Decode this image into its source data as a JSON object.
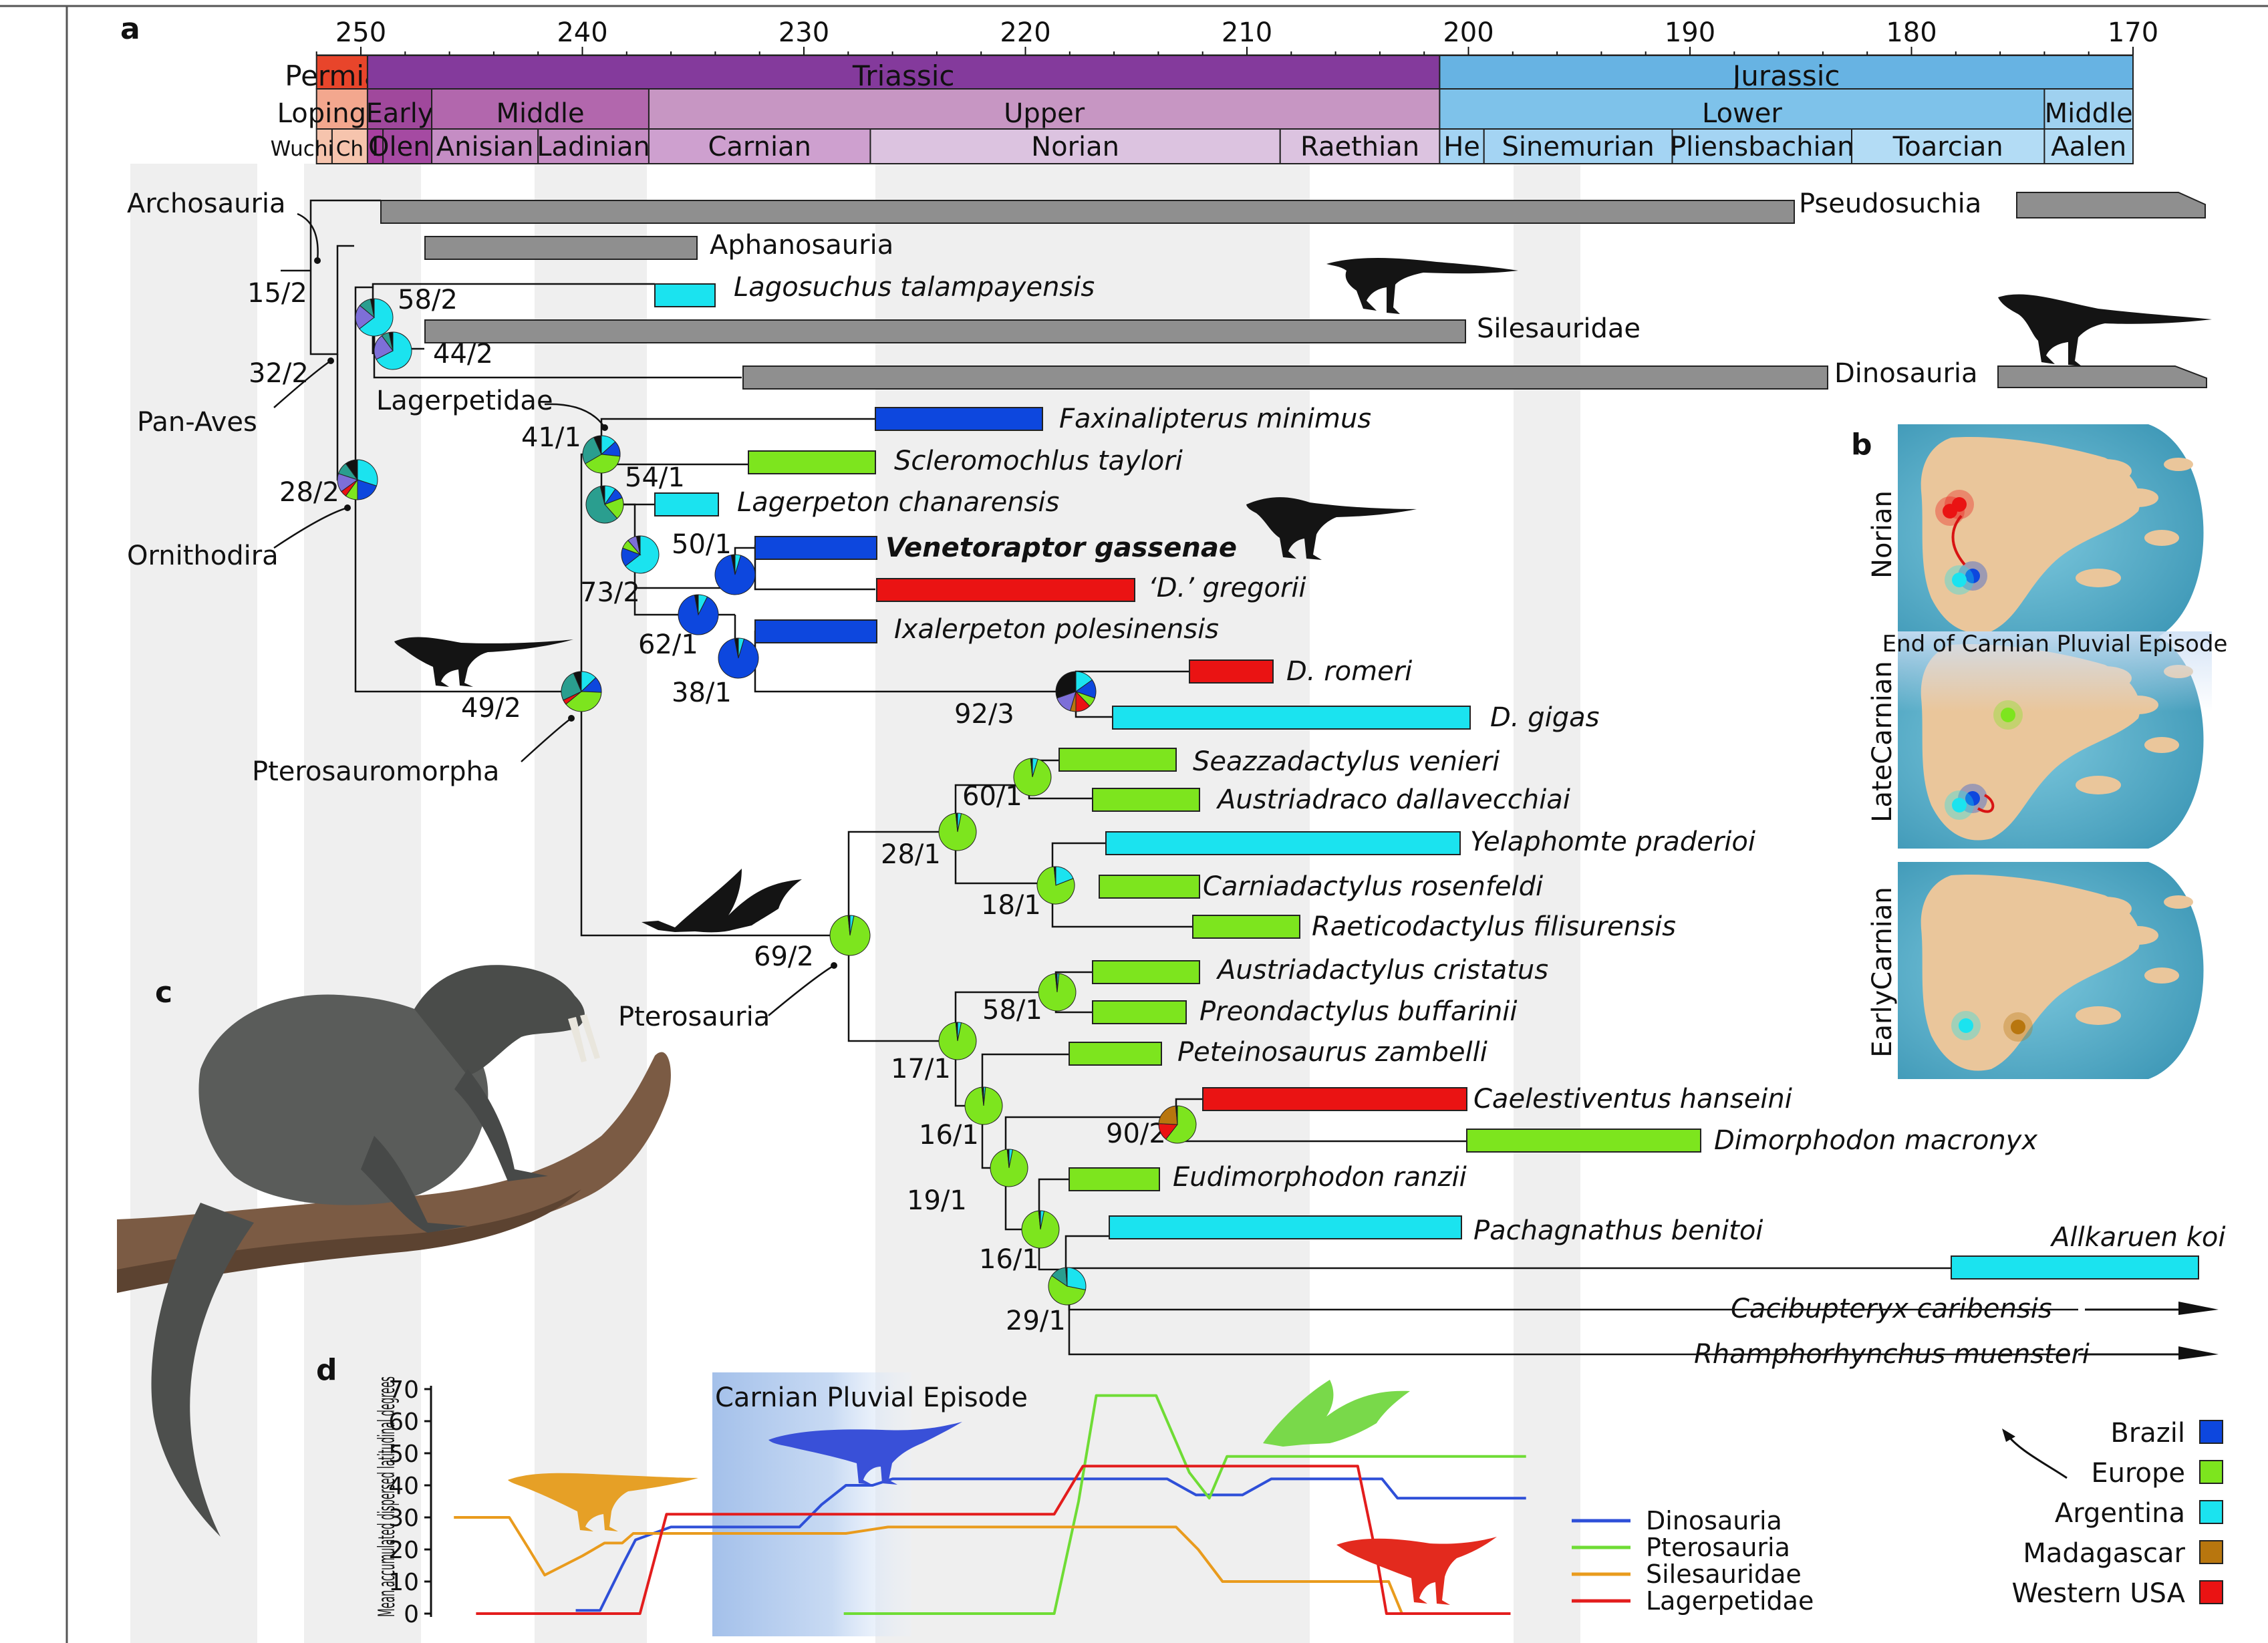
{
  "panel_labels": {
    "a": "a",
    "b": "b",
    "c": "c",
    "d": "d"
  },
  "timescale": {
    "ticks": [
      "250",
      "240",
      "230",
      "220",
      "210",
      "200",
      "190",
      "180",
      "170"
    ],
    "periods": [
      "Permian",
      "Triassic",
      "Jurassic"
    ],
    "epochs": [
      "Lopingian",
      "Early",
      "Middle",
      "Upper",
      "Lower",
      "Middle"
    ],
    "stages": [
      "Wuchiapin",
      "Ch",
      "I",
      "Olene",
      "Anisian",
      "Ladinian",
      "Carnian",
      "Norian",
      "Raethian",
      "He",
      "Sinemurian",
      "Pliensbachian",
      "Toarcian",
      "Aalen"
    ]
  },
  "tree": {
    "taxa": [
      {
        "name": "Pseudosuchia",
        "italic": false,
        "bold": false,
        "color": "#8f8f8f"
      },
      {
        "name": "Aphanosauria",
        "italic": false,
        "bold": false,
        "color": "#8f8f8f"
      },
      {
        "name": "Lagosuchus talampayensis",
        "italic": true,
        "bold": false,
        "color": "#1be3ef"
      },
      {
        "name": "Silesauridae",
        "italic": false,
        "bold": false,
        "color": "#8f8f8f"
      },
      {
        "name": "Dinosauria",
        "italic": false,
        "bold": false,
        "color": "#8f8f8f"
      },
      {
        "name": "Faxinalipterus minimus",
        "italic": true,
        "bold": false,
        "color": "#0d47de"
      },
      {
        "name": "Scleromochlus taylori",
        "italic": true,
        "bold": false,
        "color": "#7de51e"
      },
      {
        "name": "Lagerpeton chanarensis",
        "italic": true,
        "bold": false,
        "color": "#1be3ef"
      },
      {
        "name": "Venetoraptor gassenae",
        "italic": true,
        "bold": true,
        "color": "#0d47de"
      },
      {
        "name": "‘D.’ gregorii",
        "italic": true,
        "bold": false,
        "color": "#ea1313"
      },
      {
        "name": "Ixalerpeton polesinensis",
        "italic": true,
        "bold": false,
        "color": "#0d47de"
      },
      {
        "name": "D. romeri",
        "italic": true,
        "bold": false,
        "color": "#ea1313"
      },
      {
        "name": "D. gigas",
        "italic": true,
        "bold": false,
        "color": "#1be3ef"
      },
      {
        "name": "Seazzadactylus venieri",
        "italic": true,
        "bold": false,
        "color": "#7de51e"
      },
      {
        "name": "Austriadraco dallavecchiai",
        "italic": true,
        "bold": false,
        "color": "#7de51e"
      },
      {
        "name": "Yelaphomte praderioi",
        "italic": true,
        "bold": false,
        "color": "#1be3ef"
      },
      {
        "name": "Carniadactylus rosenfeldi",
        "italic": true,
        "bold": false,
        "color": "#7de51e"
      },
      {
        "name": "Raeticodactylus filisurensis",
        "italic": true,
        "bold": false,
        "color": "#7de51e"
      },
      {
        "name": "Austriadactylus cristatus",
        "italic": true,
        "bold": false,
        "color": "#7de51e"
      },
      {
        "name": "Preondactylus buffarinii",
        "italic": true,
        "bold": false,
        "color": "#7de51e"
      },
      {
        "name": "Peteinosaurus zambelli",
        "italic": true,
        "bold": false,
        "color": "#7de51e"
      },
      {
        "name": "Caelestiventus hanseini",
        "italic": true,
        "bold": false,
        "color": "#ea1313"
      },
      {
        "name": "Dimorphodon macronyx",
        "italic": true,
        "bold": false,
        "color": "#7de51e"
      },
      {
        "name": "Eudimorphodon ranzii",
        "italic": true,
        "bold": false,
        "color": "#7de51e"
      },
      {
        "name": "Pachagnathus benitoi",
        "italic": true,
        "bold": false,
        "color": "#1be3ef"
      },
      {
        "name": "Allkaruen koi",
        "italic": true,
        "bold": false,
        "color": "#1be3ef"
      },
      {
        "name": "Cacibupteryx caribensis",
        "italic": true,
        "bold": false,
        "color": ""
      },
      {
        "name": "Rhamphorhynchus muensteri",
        "italic": true,
        "bold": false,
        "color": ""
      }
    ],
    "clades": [
      "Archosauria",
      "Pan-Aves",
      "Ornithodira",
      "Lagerpetidae",
      "Pterosauromorpha",
      "Pterosauria"
    ],
    "node_labels": [
      "15/2",
      "58/2",
      "32/2",
      "44/2",
      "28/2",
      "41/1",
      "54/1",
      "50/1",
      "73/2",
      "62/1",
      "38/1",
      "92/3",
      "49/2",
      "60/1",
      "28/1",
      "18/1",
      "69/2",
      "58/1",
      "17/1",
      "16/1",
      "90/2",
      "19/1",
      "16/1",
      "29/1"
    ]
  },
  "maps": {
    "rows": [
      "Norian",
      "LateCarnian",
      "EarlyCarnian"
    ],
    "event_label": "End of Carnian Pluvial Episode"
  },
  "legend": {
    "items": [
      {
        "label": "Brazil",
        "color": "#0d47de"
      },
      {
        "label": "Europe",
        "color": "#7de51e"
      },
      {
        "label": "Argentina",
        "color": "#1be3ef"
      },
      {
        "label": "Madagascar",
        "color": "#b8760e"
      },
      {
        "label": "Western USA",
        "color": "#ea1313"
      }
    ]
  },
  "chart_data": {
    "type": "line",
    "title": "",
    "xlabel": "",
    "ylabel": "Mean accumulated dispersed latitudinal degrees",
    "ylim": [
      0,
      70
    ],
    "yticks": [
      0,
      10,
      20,
      30,
      40,
      50,
      60,
      70
    ],
    "xlim_ma": [
      252,
      170
    ],
    "annotation": "Carnian Pluvial Episode",
    "series": [
      {
        "name": "Dinosauria",
        "color": "#2e4fd8",
        "points": [
          [
            240.3,
            1
          ],
          [
            239.2,
            1
          ],
          [
            238.2,
            15
          ],
          [
            237.6,
            23
          ],
          [
            236.0,
            27
          ],
          [
            230.2,
            27
          ],
          [
            229.2,
            34
          ],
          [
            228.1,
            40
          ],
          [
            226.9,
            40
          ],
          [
            226.0,
            42
          ],
          [
            213.6,
            42
          ],
          [
            212.3,
            37
          ],
          [
            210.2,
            37
          ],
          [
            208.9,
            42
          ],
          [
            203.9,
            42
          ],
          [
            203.2,
            36
          ],
          [
            197.4,
            36
          ]
        ]
      },
      {
        "name": "Pterosauria",
        "color": "#6fdc35",
        "points": [
          [
            228.2,
            0
          ],
          [
            218.7,
            0
          ],
          [
            217.6,
            35
          ],
          [
            216.8,
            68
          ],
          [
            214.1,
            68
          ],
          [
            212.6,
            44
          ],
          [
            211.7,
            36
          ],
          [
            210.9,
            49
          ],
          [
            197.4,
            49
          ]
        ]
      },
      {
        "name": "Silesauridae",
        "color": "#e99b1d",
        "points": [
          [
            245.8,
            30
          ],
          [
            243.3,
            30
          ],
          [
            242.4,
            20
          ],
          [
            241.7,
            12
          ],
          [
            240.0,
            18
          ],
          [
            239.0,
            22
          ],
          [
            238.2,
            22
          ],
          [
            237.7,
            25
          ],
          [
            228.1,
            25
          ],
          [
            226.2,
            27
          ],
          [
            213.2,
            27
          ],
          [
            212.2,
            20
          ],
          [
            211.1,
            10
          ],
          [
            203.6,
            10
          ],
          [
            203.0,
            0
          ],
          [
            201.8,
            0
          ]
        ]
      },
      {
        "name": "Lagerpetidae",
        "color": "#e31d1d",
        "points": [
          [
            244.8,
            0
          ],
          [
            242.4,
            0
          ],
          [
            241.6,
            0
          ],
          [
            237.4,
            0
          ],
          [
            236.2,
            31
          ],
          [
            218.7,
            31
          ],
          [
            217.4,
            46
          ],
          [
            205.0,
            46
          ],
          [
            204.1,
            16
          ],
          [
            203.7,
            0
          ],
          [
            198.1,
            0
          ]
        ]
      }
    ]
  }
}
